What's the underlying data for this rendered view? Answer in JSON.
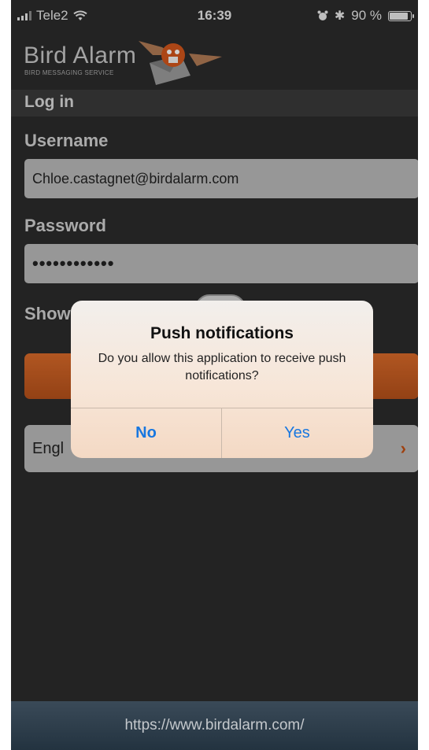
{
  "status": {
    "carrier": "Tele2",
    "time": "16:39",
    "battery": "90 %",
    "battery_level": 0.9
  },
  "header": {
    "logo_title": "Bird Alarm",
    "logo_subtitle": "BIRD MESSAGING SERVICE"
  },
  "login": {
    "section_title": "Log in",
    "username_label": "Username",
    "username_value": "Chloe.castagnet@birdalarm.com",
    "password_label": "Password",
    "password_value": "••••••••••••",
    "show_label": "Show",
    "language_value": "Engl"
  },
  "alert": {
    "title": "Push notifications",
    "message": "Do you allow this application to receive push notifications?",
    "no_label": "No",
    "yes_label": "Yes"
  },
  "footer": {
    "url": "https://www.birdalarm.com/"
  },
  "colors": {
    "accent_orange": "#c8581f",
    "ios_blue": "#1877e0",
    "background": "#2b2b2b"
  }
}
